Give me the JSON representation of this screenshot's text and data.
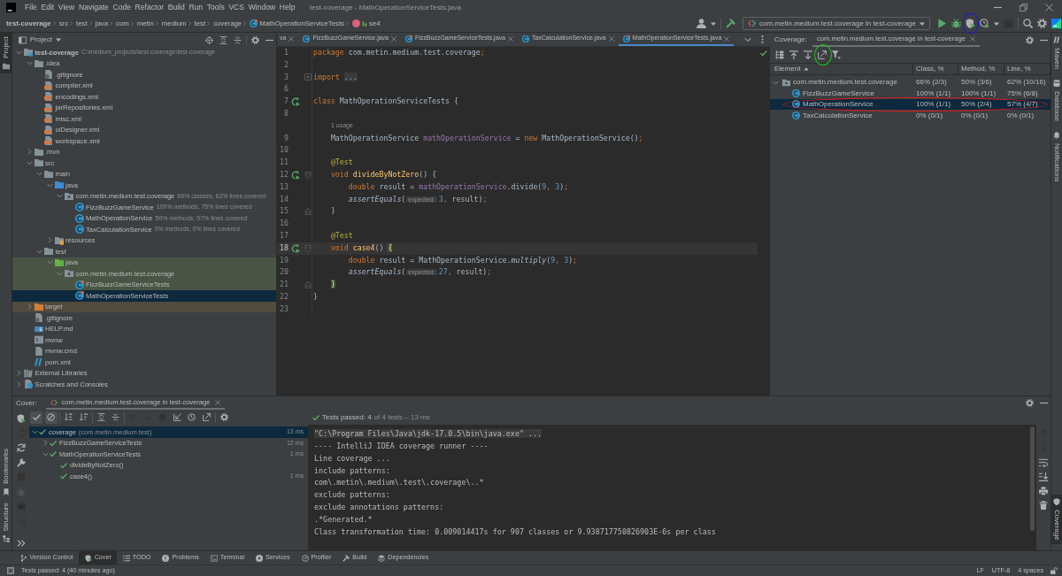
{
  "title_bar": {
    "menu": [
      "File",
      "Edit",
      "View",
      "Navigate",
      "Code",
      "Refactor",
      "Build",
      "Run",
      "Tools",
      "VCS",
      "Window",
      "Help"
    ],
    "title": "test-coverage - MathOperationServiceTests.java"
  },
  "navigation_bar": {
    "breadcrumbs": [
      {
        "label": "test-coverage",
        "kind": "project"
      },
      {
        "label": "src",
        "kind": "directory"
      },
      {
        "label": "test",
        "kind": "directory"
      },
      {
        "label": "java",
        "kind": "directory"
      },
      {
        "label": "com",
        "kind": "directory"
      },
      {
        "label": "metin",
        "kind": "directory"
      },
      {
        "label": "medium",
        "kind": "directory"
      },
      {
        "label": "test",
        "kind": "directory"
      },
      {
        "label": "coverage",
        "kind": "directory"
      },
      {
        "label": "MathOperationServiceTests",
        "kind": "test-class"
      },
      {
        "label": "se4",
        "kind": "method"
      }
    ],
    "toolbar": [
      {
        "kind": "user",
        "disabled": false
      },
      {
        "kind": "build",
        "disabled": false
      },
      {
        "kind": "run-config",
        "label": "com.metin.medium.test.coverage in test-coverage"
      },
      {
        "kind": "run",
        "disabled": false
      },
      {
        "kind": "debug",
        "disabled": false
      },
      {
        "kind": "coverage",
        "disabled": false,
        "annotation": {
          "color": "#1c1cd4"
        }
      },
      {
        "kind": "profile",
        "disabled": false
      },
      {
        "kind": "stop",
        "disabled": true
      },
      {
        "kind": "search",
        "disabled": false
      },
      {
        "kind": "settings",
        "disabled": false
      },
      {
        "kind": "toolbox",
        "disabled": false
      }
    ]
  },
  "left_stripe": {
    "top": [
      {
        "label": "Project",
        "kind": "project",
        "selected": true
      }
    ],
    "bottom": [
      {
        "label": "Bookmarks",
        "kind": "bookmarks",
        "selected": false
      },
      {
        "label": "Structure",
        "kind": "structure",
        "selected": false
      }
    ]
  },
  "project_panel": {
    "title": "Project",
    "tree": [
      {
        "label": "test-coverage",
        "kind": "module",
        "note": "C:\\medium_projects\\test-coverage\\test-coverage",
        "expanded": true,
        "selected": false,
        "children": [
          {
            "label": ".idea",
            "kind": "folder",
            "expanded": true,
            "selected": false,
            "children": [
              {
                "label": ".gitignore",
                "kind": "gitignore",
                "selected": false
              },
              {
                "label": "compiler.xml",
                "kind": "xml",
                "selected": false
              },
              {
                "label": "encodings.xml",
                "kind": "xml",
                "selected": false
              },
              {
                "label": "jarRepositories.xml",
                "kind": "xml",
                "selected": false
              },
              {
                "label": "misc.xml",
                "kind": "xml",
                "selected": false
              },
              {
                "label": "uiDesigner.xml",
                "kind": "xml",
                "selected": false
              },
              {
                "label": "workspace.xml",
                "kind": "xml",
                "selected": false
              }
            ]
          },
          {
            "label": ".mvn",
            "kind": "folder",
            "expanded": false,
            "selected": false
          },
          {
            "label": "src",
            "kind": "folder",
            "expanded": true,
            "selected": false,
            "children": [
              {
                "label": "main",
                "kind": "folder",
                "expanded": true,
                "selected": false,
                "children": [
                  {
                    "label": "java",
                    "kind": "source-folder",
                    "expanded": true,
                    "selected": false,
                    "children": [
                      {
                        "label": "com.metin.medium.test.coverage",
                        "kind": "package",
                        "note": "66% classes, 62% lines covered",
                        "expanded": true,
                        "selected": false,
                        "children": [
                          {
                            "label": "FizzBuzzGameService",
                            "kind": "class",
                            "note": "100% methods, 75% lines covered",
                            "selected": false
                          },
                          {
                            "label": "MathOperationService",
                            "kind": "class",
                            "note": "50% methods, 57% lines covered",
                            "selected": false
                          },
                          {
                            "label": "TaxCalculationService",
                            "kind": "class",
                            "note": "0% methods, 0% lines covered",
                            "selected": false
                          }
                        ]
                      }
                    ]
                  },
                  {
                    "label": "resources",
                    "kind": "resource-folder",
                    "expanded": false,
                    "selected": false
                  }
                ]
              },
              {
                "label": "test",
                "kind": "folder",
                "expanded": true,
                "selected": false,
                "children": [
                  {
                    "label": "java",
                    "kind": "test-folder",
                    "expanded": true,
                    "selected": false,
                    "color": "#4a5444",
                    "children": [
                      {
                        "label": "com.metin.medium.test.coverage",
                        "kind": "package",
                        "expanded": true,
                        "selected": false,
                        "color": "#4a5444",
                        "children": [
                          {
                            "label": "FizzBuzzGameServiceTests",
                            "kind": "test-class",
                            "selected": false,
                            "color": "#4a5444"
                          },
                          {
                            "label": "MathOperationServiceTests",
                            "kind": "test-class",
                            "selected": true
                          }
                        ]
                      }
                    ]
                  }
                ]
              }
            ]
          },
          {
            "label": "target",
            "kind": "excluded-folder",
            "expanded": false,
            "selected": false,
            "color": "#514a3e"
          },
          {
            "label": ".gitignore",
            "kind": "gitignore",
            "selected": false
          },
          {
            "label": "HELP.md",
            "kind": "markdown",
            "selected": false
          },
          {
            "label": "mvnw",
            "kind": "script",
            "selected": false
          },
          {
            "label": "mvnw.cmd",
            "kind": "text-file",
            "selected": false
          },
          {
            "label": "pom.xml",
            "kind": "maven",
            "selected": false
          }
        ]
      },
      {
        "label": "External Libraries",
        "kind": "libraries",
        "expanded": false,
        "selected": false
      },
      {
        "label": "Scratches and Consoles",
        "kind": "scratches",
        "expanded": false,
        "selected": false
      }
    ]
  },
  "editor": {
    "tabs": [
      {
        "label": "va",
        "kind": "clipped",
        "selected": false
      },
      {
        "label": "FizzBuzzGameService.java",
        "kind": "class",
        "selected": false
      },
      {
        "label": "FizzBuzzGameServiceTests.java",
        "kind": "test-class",
        "selected": false
      },
      {
        "label": "TaxCalculationService.java",
        "kind": "class",
        "selected": false
      },
      {
        "label": "MathOperationServiceTests.java",
        "kind": "test-class",
        "selected": true
      }
    ],
    "lines": [
      {
        "kind": "code",
        "number": "1",
        "current": false,
        "tokens": [
          {
            "kind": "keyword",
            "text": "package"
          },
          {
            "kind": "plain",
            "text": " com.metin.medium.test.coverage"
          },
          {
            "kind": "keyword",
            "text": ";"
          }
        ]
      },
      {
        "kind": "code",
        "number": "2",
        "current": false
      },
      {
        "kind": "code",
        "number": "3",
        "current": false,
        "gutter": [
          {
            "kind": "fold-collapsed"
          }
        ],
        "tokens": [
          {
            "kind": "keyword",
            "text": "import"
          },
          {
            "kind": "folded",
            "text": " ..."
          }
        ]
      },
      {
        "kind": "code",
        "number": "6",
        "current": false
      },
      {
        "kind": "code",
        "number": "7",
        "current": false,
        "gutter": [
          {
            "kind": "run"
          }
        ],
        "tokens": [
          {
            "kind": "keyword",
            "text": "class"
          },
          {
            "kind": "plain",
            "text": " MathOperationServiceTests {"
          }
        ]
      },
      {
        "kind": "code",
        "number": "8",
        "current": false
      },
      {
        "kind": "usage",
        "text": "1 usage"
      },
      {
        "kind": "code",
        "number": "9",
        "current": false,
        "tokens": [
          {
            "kind": "plain",
            "text": "    MathOperationService "
          },
          {
            "kind": "field",
            "text": "mathOperationService"
          },
          {
            "kind": "plain",
            "text": " = "
          },
          {
            "kind": "keyword",
            "text": "new"
          },
          {
            "kind": "plain",
            "text": " MathOperationService()"
          },
          {
            "kind": "keyword",
            "text": ";"
          }
        ]
      },
      {
        "kind": "code",
        "number": "10",
        "current": false
      },
      {
        "kind": "code",
        "number": "11",
        "current": false,
        "tokens": [
          {
            "kind": "annotation",
            "text": "    @Test"
          }
        ]
      },
      {
        "kind": "code",
        "number": "12",
        "current": false,
        "gutter": [
          {
            "kind": "run"
          },
          {
            "kind": "fold-start"
          }
        ],
        "tokens": [
          {
            "kind": "keyword",
            "text": "    void"
          },
          {
            "kind": "method",
            "text": " divideByNotZero"
          },
          {
            "kind": "plain",
            "text": "() {"
          }
        ]
      },
      {
        "kind": "code",
        "number": "13",
        "current": false,
        "tokens": [
          {
            "kind": "keyword",
            "text": "        double"
          },
          {
            "kind": "plain",
            "text": " result = "
          },
          {
            "kind": "field",
            "text": "mathOperationService"
          },
          {
            "kind": "plain",
            "text": ".divide("
          },
          {
            "kind": "number",
            "text": "9"
          },
          {
            "kind": "keyword",
            "text": ", "
          },
          {
            "kind": "number",
            "text": "3"
          },
          {
            "kind": "plain",
            "text": ")"
          },
          {
            "kind": "keyword",
            "text": ";"
          }
        ]
      },
      {
        "kind": "code",
        "number": "14",
        "current": false,
        "tokens": [
          {
            "kind": "static",
            "text": "        assertEquals"
          },
          {
            "kind": "plain",
            "text": "("
          },
          {
            "kind": "hint",
            "text": "expected:"
          },
          {
            "kind": "number",
            "text": "3"
          },
          {
            "kind": "keyword",
            "text": ", "
          },
          {
            "kind": "plain",
            "text": "result)"
          },
          {
            "kind": "keyword",
            "text": ";"
          }
        ]
      },
      {
        "kind": "code",
        "number": "15",
        "current": false,
        "gutter": [
          {
            "kind": "fold-end"
          }
        ],
        "tokens": [
          {
            "kind": "plain",
            "text": "    }"
          }
        ]
      },
      {
        "kind": "code",
        "number": "16",
        "current": false
      },
      {
        "kind": "code",
        "number": "17",
        "current": false,
        "tokens": [
          {
            "kind": "annotation",
            "text": "    @Test"
          }
        ]
      },
      {
        "kind": "code",
        "number": "18",
        "current": true,
        "gutter": [
          {
            "kind": "run"
          },
          {
            "kind": "fold-start"
          }
        ],
        "tokens": [
          {
            "kind": "keyword",
            "text": "    void"
          },
          {
            "kind": "method",
            "text": " case4"
          },
          {
            "kind": "plain",
            "text": "() "
          },
          {
            "kind": "brace",
            "text": "{"
          }
        ]
      },
      {
        "kind": "code",
        "number": "19",
        "current": false,
        "tokens": [
          {
            "kind": "keyword",
            "text": "        double"
          },
          {
            "kind": "plain",
            "text": " result = MathOperationService."
          },
          {
            "kind": "static",
            "text": "multiply"
          },
          {
            "kind": "plain",
            "text": "("
          },
          {
            "kind": "number",
            "text": "9"
          },
          {
            "kind": "keyword",
            "text": ", "
          },
          {
            "kind": "number",
            "text": "3"
          },
          {
            "kind": "plain",
            "text": ")"
          },
          {
            "kind": "keyword",
            "text": ";"
          }
        ]
      },
      {
        "kind": "code",
        "number": "20",
        "current": false,
        "tokens": [
          {
            "kind": "static",
            "text": "        assertEquals"
          },
          {
            "kind": "plain",
            "text": "("
          },
          {
            "kind": "hint",
            "text": "expected:"
          },
          {
            "kind": "number",
            "text": "27"
          },
          {
            "kind": "keyword",
            "text": ", "
          },
          {
            "kind": "plain",
            "text": "result)"
          },
          {
            "kind": "keyword",
            "text": ";"
          }
        ]
      },
      {
        "kind": "code",
        "number": "21",
        "current": false,
        "gutter": [
          {
            "kind": "fold-end"
          }
        ],
        "tokens": [
          {
            "kind": "brace",
            "text": "    }"
          }
        ]
      },
      {
        "kind": "code",
        "number": "22",
        "current": false,
        "tokens": [
          {
            "kind": "plain",
            "text": "}"
          }
        ]
      },
      {
        "kind": "code",
        "number": "23",
        "current": false
      }
    ]
  },
  "coverage_panel": {
    "label": "Coverage:",
    "tab": "com.metin.medium.test.coverage in test-coverage",
    "toolbar": [
      {
        "kind": "flatten"
      },
      {
        "kind": "up-to-bar"
      },
      {
        "kind": "down-to-bar"
      },
      {
        "kind": "report",
        "annotation": {
          "color": "#1ec41e"
        }
      },
      {
        "kind": "filter"
      }
    ],
    "columns": [
      {
        "label": "Element",
        "sorted": true
      },
      {
        "label": "Class, %",
        "sorted": false
      },
      {
        "label": "Method, %",
        "sorted": false
      },
      {
        "label": "Line, %",
        "sorted": false
      }
    ],
    "rows": [
      {
        "element": "com.metin.medium.test.coverage",
        "kind": "package",
        "class": "66% (2/3)",
        "method": "50% (3/6)",
        "line": "62% (10/16)",
        "expanded": true,
        "selected": false,
        "children": [
          {
            "element": "FizzBuzzGameService",
            "kind": "class",
            "class": "100% (1/1)",
            "method": "100% (1/1)",
            "line": "75% (6/8)",
            "selected": false
          },
          {
            "element": "MathOperationService",
            "kind": "class",
            "class": "100% (1/1)",
            "method": "50% (2/4)",
            "line": "57% (4/7)",
            "selected": true,
            "annotation": {
              "color": "#e01c1c"
            }
          },
          {
            "element": "TaxCalculationService",
            "kind": "class",
            "class": "0% (0/1)",
            "method": "0% (0/1)",
            "line": "0% (0/1)",
            "selected": false
          }
        ]
      }
    ]
  },
  "right_stripe": {
    "top": [
      {
        "label": "Maven",
        "kind": "maven",
        "selected": false
      },
      {
        "label": "Database",
        "kind": "database",
        "selected": false
      },
      {
        "label": "Notifications",
        "kind": "notifications",
        "selected": false
      }
    ],
    "bottom": [
      {
        "label": "Coverage",
        "kind": "coverage",
        "selected": true
      }
    ]
  },
  "bottom_panel": {
    "label": "Cover:",
    "tab": "com.metin.medium.test.coverage in test-coverage",
    "side_toolbar": [
      {
        "kind": "rerun-coverage",
        "disabled": false
      },
      {
        "kind": "rerun-failed",
        "disabled": true
      },
      {
        "kind": "auto-test",
        "disabled": false
      },
      {
        "kind": "wrench",
        "disabled": false
      },
      {
        "kind": "stop",
        "disabled": true
      },
      {
        "kind": "debug",
        "disabled": true
      },
      {
        "kind": "camera",
        "disabled": true
      },
      {
        "kind": "exit",
        "disabled": true
      },
      {
        "kind": "more",
        "disabled": false
      }
    ],
    "test_toolbar": [
      {
        "kind": "show-passed",
        "on": true,
        "disabled": false
      },
      {
        "kind": "show-ignored",
        "on": true,
        "disabled": false
      },
      {
        "kind": "sort-alpha",
        "on": false,
        "disabled": false
      },
      {
        "kind": "sort-duration",
        "on": false,
        "disabled": false
      },
      {
        "kind": "expand",
        "on": false,
        "disabled": false
      },
      {
        "kind": "collapse",
        "on": false,
        "disabled": false
      },
      {
        "kind": "previous",
        "on": false,
        "disabled": true
      },
      {
        "kind": "next",
        "on": false,
        "disabled": true
      },
      {
        "kind": "shield",
        "on": false,
        "disabled": true
      },
      {
        "kind": "import",
        "on": false,
        "disabled": false
      },
      {
        "kind": "history",
        "on": false,
        "disabled": false
      },
      {
        "kind": "export",
        "on": false,
        "disabled": false
      },
      {
        "kind": "settings",
        "on": false,
        "disabled": false
      }
    ],
    "summary": {
      "passed": "Tests passed: 4",
      "detail": "of 4 tests – 13 ms"
    },
    "tests": [
      {
        "label": "coverage",
        "note": "(com.metin.medium.test)",
        "time": "13 ms",
        "passed": true,
        "expanded": true,
        "selected": true,
        "children": [
          {
            "label": "FizzBuzzGameServiceTests",
            "time": "12 ms",
            "passed": true,
            "expanded": false,
            "selected": false
          },
          {
            "label": "MathOperationServiceTests",
            "time": "1 ms",
            "passed": true,
            "expanded": true,
            "selected": false,
            "children": [
              {
                "label": "divideByNotZero()",
                "passed": true,
                "selected": false
              },
              {
                "label": "case4()",
                "time": "1 ms",
                "passed": true,
                "selected": false
              }
            ]
          }
        ]
      }
    ],
    "console": [
      {
        "kind": "folded",
        "text": "\"C:\\Program Files\\Java\\jdk-17.0.5\\bin\\java.exe\" ..."
      },
      {
        "kind": "output",
        "text": "---- IntelliJ IDEA coverage runner ----"
      },
      {
        "kind": "output",
        "text": "Line coverage ..."
      },
      {
        "kind": "output",
        "text": "include patterns:"
      },
      {
        "kind": "output",
        "text": "com\\.metin\\.medium\\.test\\.coverage\\..*"
      },
      {
        "kind": "output",
        "text": "exclude patterns:"
      },
      {
        "kind": "output",
        "text": "exclude annotations patterns:"
      },
      {
        "kind": "output",
        "text": ".*Generated.*"
      },
      {
        "kind": "output",
        "text": "Class transformation time: 0.009014417s for 907 classes or 9.938717750826903E-6s per class"
      }
    ],
    "console_toolbar": [
      {
        "kind": "up",
        "disabled": true
      },
      {
        "kind": "down",
        "disabled": true
      },
      {
        "kind": "wrap",
        "disabled": false
      },
      {
        "kind": "scroll-end",
        "disabled": false
      },
      {
        "kind": "print",
        "disabled": false
      },
      {
        "kind": "clear",
        "disabled": false
      }
    ]
  },
  "tool_windows": [
    {
      "label": "Version Control",
      "kind": "vcs",
      "selected": false
    },
    {
      "label": "Cover",
      "kind": "cover",
      "selected": true
    },
    {
      "label": "TODO",
      "kind": "todo",
      "selected": false
    },
    {
      "label": "Problems",
      "kind": "problems",
      "selected": false
    },
    {
      "label": "Terminal",
      "kind": "terminal",
      "selected": false
    },
    {
      "label": "Services",
      "kind": "services",
      "selected": false
    },
    {
      "label": "Profiler",
      "kind": "profiler",
      "selected": false
    },
    {
      "label": "Build",
      "kind": "build",
      "selected": false
    },
    {
      "label": "Dependencies",
      "kind": "dependencies",
      "selected": false
    }
  ],
  "status_bar": {
    "message": "Tests passed: 4 (40 minutes ago)",
    "widgets": [
      "LF",
      "UTF-8",
      "4 spaces"
    ]
  }
}
